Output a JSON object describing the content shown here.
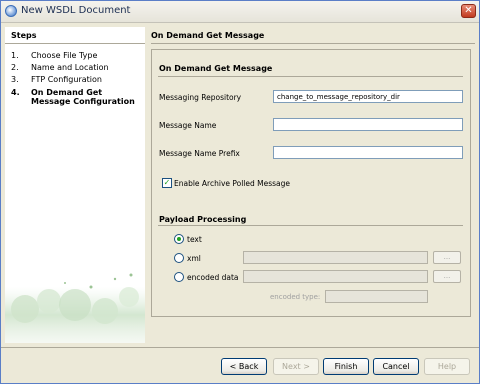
{
  "window": {
    "title": "New WSDL Document",
    "close_label": "✕"
  },
  "steps": {
    "title": "Steps",
    "items": [
      {
        "num": "1.",
        "label": "Choose File Type"
      },
      {
        "num": "2.",
        "label": "Name and Location"
      },
      {
        "num": "3.",
        "label": "FTP Configuration"
      },
      {
        "num": "4.",
        "label": "On Demand Get Message Configuration"
      }
    ]
  },
  "panel": {
    "title": "On Demand Get Message",
    "section_title": "On Demand Get Message",
    "messaging_repository": {
      "label": "Messaging Repository",
      "value": "change_to_message_repository_dir"
    },
    "message_name": {
      "label": "Message Name",
      "value": ""
    },
    "message_name_prefix": {
      "label": "Message Name Prefix",
      "value": ""
    },
    "enable_archive": {
      "label": "Enable Archive Polled Message",
      "checked": true,
      "check_glyph": "✓"
    },
    "payload": {
      "title": "Payload Processing",
      "text_label": "text",
      "xml_label": "xml",
      "encoded_label": "encoded data",
      "browse_label": "...",
      "encoded_type_label": "encoded type:",
      "selected": "text"
    }
  },
  "buttons": {
    "back": "< Back",
    "next": "Next >",
    "finish": "Finish",
    "cancel": "Cancel",
    "help": "Help"
  }
}
